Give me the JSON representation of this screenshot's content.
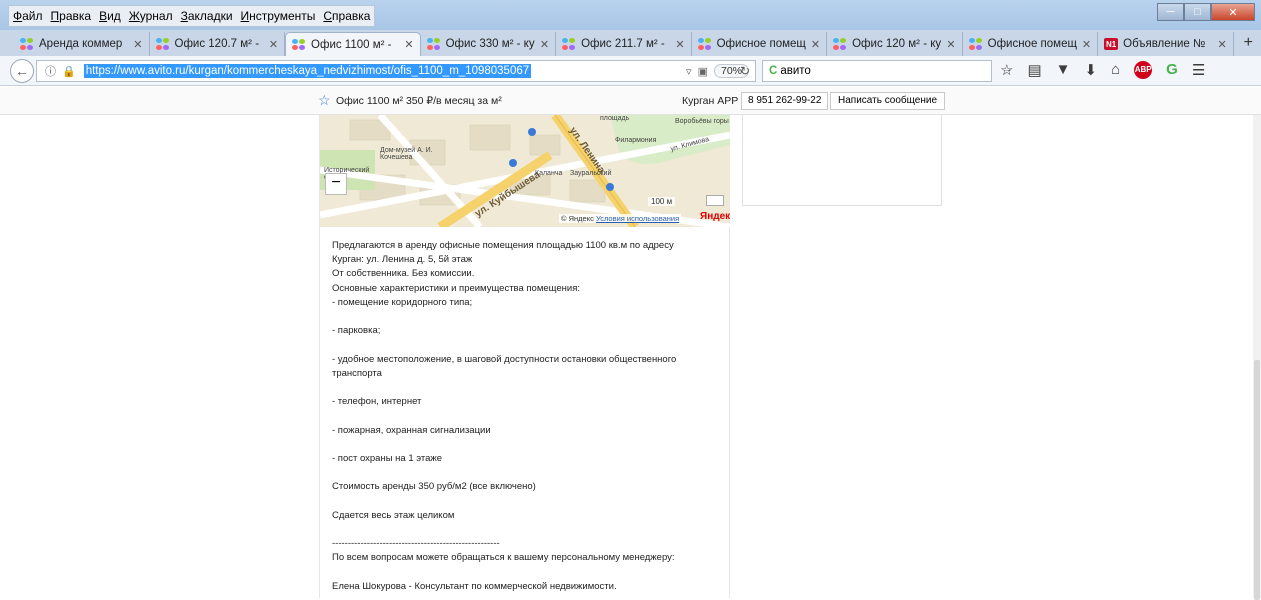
{
  "menu": [
    "Файл",
    "Правка",
    "Вид",
    "Журнал",
    "Закладки",
    "Инструменты",
    "Справка"
  ],
  "tabs": [
    {
      "label": "Аренда коммер",
      "active": false
    },
    {
      "label": "Офис 120.7 м² -",
      "active": false
    },
    {
      "label": "Офис 1100 м² -",
      "active": true
    },
    {
      "label": "Офис 330 м² - ку",
      "active": false
    },
    {
      "label": "Офис 211.7 м² -",
      "active": false
    },
    {
      "label": "Офисное помещ",
      "active": false
    },
    {
      "label": "Офис 120 м² - ку",
      "active": false
    },
    {
      "label": "Офисное помещ",
      "active": false
    },
    {
      "label": "Объявление №",
      "active": false,
      "icon": "N1"
    }
  ],
  "navbar": {
    "url": "https://www.avito.ru/kurgan/kommercheskaya_nedvizhimost/ofis_1100_m_1098035067",
    "zoom": "70%",
    "search_value": "авито"
  },
  "sticky": {
    "title": "Офис 1100 м²   350 ₽/в месяц за м²",
    "company": "Курган АРР",
    "phone": "8 951 262-99-22",
    "message_button": "Написать сообщение"
  },
  "map": {
    "street_lenina": "ул. Ленина",
    "street_kuibysheva": "ул. Куйбышева",
    "street_klimova": "ул. Климова",
    "label_square": "площадь",
    "label_vorobyovy": "Воробьёвы горы",
    "label_philharmonic": "Филармония",
    "label_museum": "Дом-музей А. И. Кочешева",
    "label_square2": "Исторический сквер",
    "label_kalanna": "Каланча",
    "label_zauralsky": "Зауральский",
    "scale": "100 м",
    "copyright": "© Яндекс",
    "terms": "Условия использования",
    "brand": "Яндекс"
  },
  "description": [
    "Предлагаются в аренду офисные помещения площадью 1100 кв.м по адресу",
    "Курган: ул. Ленина д. 5, 5й этаж",
    "От собственника. Без комиссии.",
    "Основные характеристики и преимущества помещения:",
    "- помещение коридорного типа;",
    "",
    "- парковка;",
    "",
    "- удобное местоположение, в шаговой доступности остановки общественного",
    "транспорта",
    "",
    "- телефон, интернет",
    "",
    "- пожарная, охранная сигнализации",
    "",
    "- пост охраны на 1 этаже",
    "",
    "Стоимость аренды 350 руб/м2 (все включено)",
    "",
    "Сдается весь этаж целиком",
    "",
    "-----------------------------------------------------",
    "По всем вопросам можете обращаться к вашему персональному менеджеру:",
    "",
    "Елена Шокурова - Консультант по коммерческой недвижимости."
  ]
}
